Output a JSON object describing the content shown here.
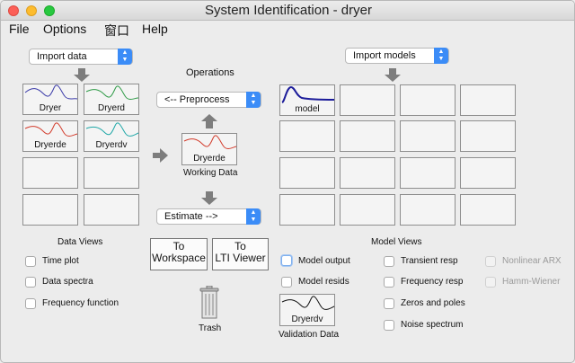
{
  "window": {
    "title": "System Identification - dryer"
  },
  "menu": [
    "File",
    "Options",
    "窗口",
    "Help"
  ],
  "import_data": {
    "label": "Import data"
  },
  "import_models": {
    "label": "Import models"
  },
  "operations": {
    "title": "Operations",
    "preprocess": "<-- Preprocess",
    "working_data_name": "Dryerde",
    "working_data_caption": "Working Data",
    "estimate": "Estimate -->"
  },
  "data_tiles": [
    "Dryer",
    "Dryerd",
    "Dryerde",
    "Dryerdv",
    "",
    "",
    "",
    ""
  ],
  "model_tiles": [
    "model"
  ],
  "data_views": {
    "title": "Data Views",
    "options": [
      "Time plot",
      "Data spectra",
      "Frequency function"
    ]
  },
  "buttons": {
    "to_workspace_1": "To",
    "to_workspace_2": "Workspace",
    "to_lti_1": "To",
    "to_lti_2": "LTI Viewer",
    "trash": "Trash"
  },
  "model_views": {
    "title": "Model Views",
    "col1": [
      "Model output",
      "Model resids"
    ],
    "validation_name": "Dryerdv",
    "validation_caption": "Validation Data",
    "col2": [
      "Transient resp",
      "Frequency resp",
      "Zeros and poles",
      "Noise spectrum"
    ],
    "col3": [
      "Nonlinear ARX",
      "Hamm-Wiener"
    ]
  },
  "colors": {
    "dryer": "#3a3aa8",
    "dryerd": "#2e9a46",
    "dryerde": "#d23b2b",
    "dryerdv": "#1ea7a7",
    "model": "#1c1c9a",
    "accent": "#3b8cf7"
  }
}
